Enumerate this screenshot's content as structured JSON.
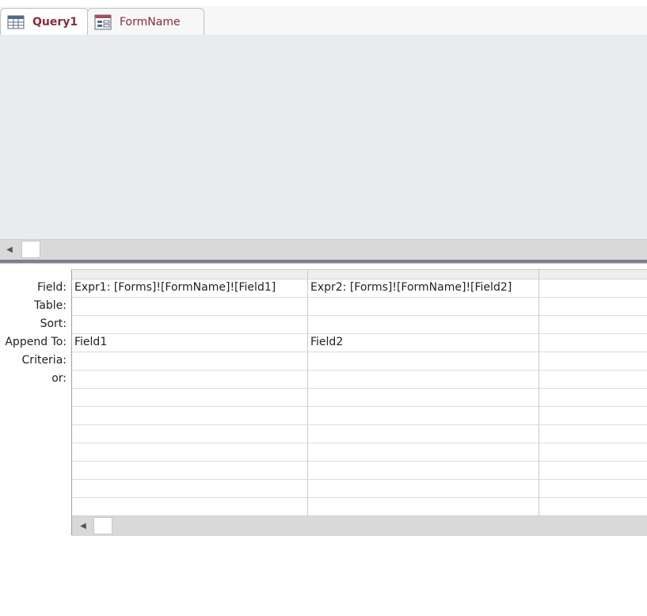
{
  "tabs": [
    {
      "label": "Query1",
      "icon": "query-icon",
      "active": true
    },
    {
      "label": "FormName",
      "icon": "form-icon",
      "active": false
    }
  ],
  "grid": {
    "row_labels": [
      "Field:",
      "Table:",
      "Sort:",
      "Append To:",
      "Criteria:",
      "or:"
    ],
    "columns": [
      {
        "field": "Expr1: [Forms]![FormName]![Field1]",
        "table": "",
        "sort": "",
        "append_to": "Field1",
        "criteria": "",
        "or": ""
      },
      {
        "field": "Expr2: [Forms]![FormName]![Field2]",
        "table": "",
        "sort": "",
        "append_to": "Field2",
        "criteria": "",
        "or": ""
      },
      {
        "field": "",
        "table": "",
        "sort": "",
        "append_to": "",
        "criteria": "",
        "or": ""
      }
    ]
  },
  "colors": {
    "active_tab_text": "#8b2a3a",
    "pane_background": "#e9ecee",
    "splitter": "#7f7f8f"
  }
}
